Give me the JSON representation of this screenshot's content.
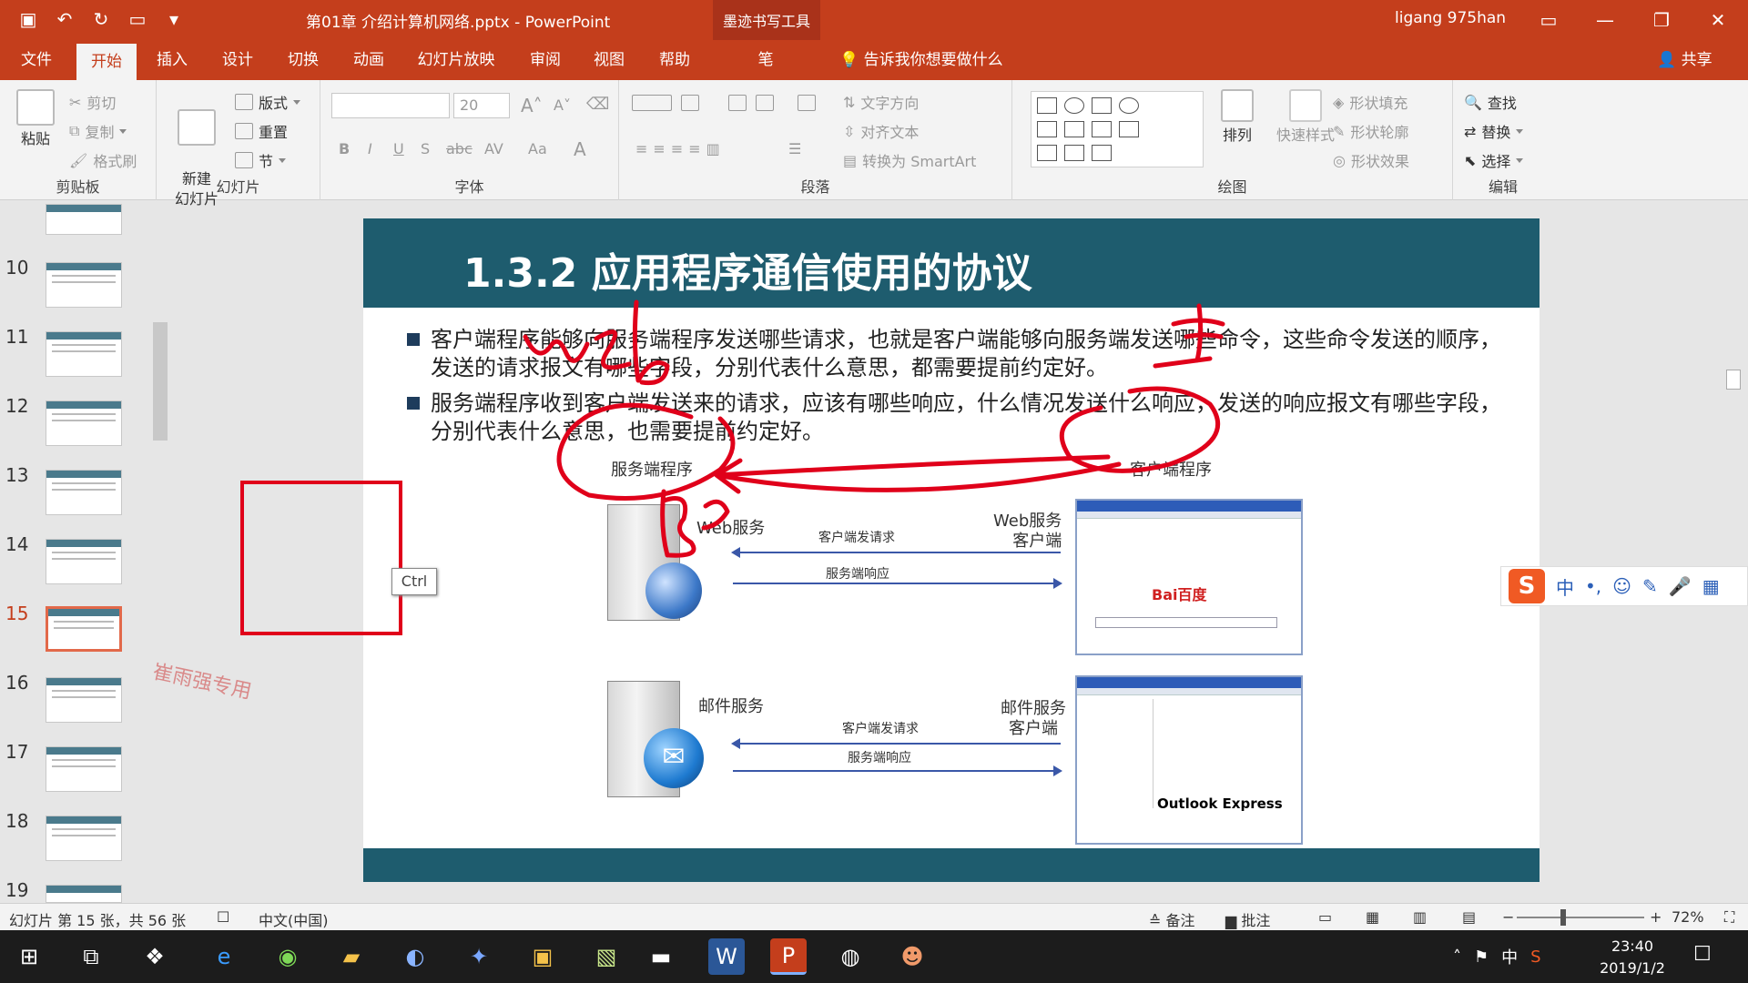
{
  "app": {
    "doc_title": "第01章 介绍计算机网络.pptx  -  PowerPoint",
    "contextual_tab": "墨迹书写工具",
    "user": "ligang 975han"
  },
  "tabs": [
    "文件",
    "开始",
    "插入",
    "设计",
    "切换",
    "动画",
    "幻灯片放映",
    "审阅",
    "视图",
    "帮助",
    "笔"
  ],
  "active_tab": "开始",
  "tell_me": "告诉我你想要做什么",
  "share": "共享",
  "ribbon": {
    "clipboard": {
      "label": "剪贴板",
      "paste": "粘贴",
      "cut": "剪切",
      "copy": "复制",
      "format_painter": "格式刷"
    },
    "slides": {
      "label": "幻灯片",
      "new_slide": "新建\n幻灯片",
      "layout": "版式",
      "reset": "重置",
      "section": "节"
    },
    "font": {
      "label": "字体",
      "font_name": "",
      "font_size": "20",
      "bold": "B",
      "italic": "I",
      "underline": "U",
      "shadow": "S",
      "strike": "abc",
      "spacing": "AV",
      "case": "Aa",
      "color": "A"
    },
    "paragraph": {
      "label": "段落",
      "text_direction": "文字方向",
      "align_text": "对齐文本",
      "smartart": "转换为 SmartArt"
    },
    "drawing": {
      "label": "绘图",
      "arrange": "排列",
      "quick_styles": "快速样式",
      "shape_fill": "形状填充",
      "shape_outline": "形状轮廓",
      "shape_effects": "形状效果"
    },
    "editing": {
      "label": "编辑",
      "find": "查找",
      "replace": "替换",
      "select": "选择"
    }
  },
  "thumbnails": [
    {
      "num": "10"
    },
    {
      "num": "11"
    },
    {
      "num": "12"
    },
    {
      "num": "13"
    },
    {
      "num": "14"
    },
    {
      "num": "15",
      "selected": true
    },
    {
      "num": "16"
    },
    {
      "num": "17"
    },
    {
      "num": "18"
    },
    {
      "num": "19"
    }
  ],
  "watermark_text": "崔雨强专用",
  "slide": {
    "title": "1.3.2 应用程序通信使用的协议",
    "bullets": [
      "客户端程序能够向服务端程序发送哪些请求，也就是客户端能够向服务端发送哪些命令，这些命令发送的顺序，发送的请求报文有哪些字段，分别代表什么意思，都需要提前约定好。",
      "服务端程序收到客户端发送来的请求，应该有哪些响应，什么情况发送什么响应，发送的响应报文有哪些字段，分别代表什么意思，也需要提前约定好。"
    ],
    "diagram": {
      "server_program": "服务端程序",
      "client_program": "客户端程序",
      "web_service": "Web服务",
      "web_client": "Web服务\n客户端",
      "mail_service": "邮件服务",
      "mail_client": "邮件服务\n客户端",
      "request": "客户端发请求",
      "response": "服务端响应",
      "baidu_logo": "Bai百度",
      "outlook_logo": "Outlook Express"
    }
  },
  "ctrl_tooltip": "Ctrl",
  "ime": {
    "lang": "中",
    "punct": "•,",
    "emoji": "☺",
    "pen": "✎",
    "mic": "🎤",
    "grid": "▦"
  },
  "status": {
    "slide_info": "幻灯片 第 15 张，共 56 张",
    "language": "中文(中国)",
    "notes": "备注",
    "comments": "批注",
    "zoom": "72%"
  },
  "taskbar": {
    "time": "23:40",
    "date": "2019/1/2",
    "ime": "中"
  },
  "colors": {
    "accent": "#c43e1c",
    "slide_header": "#1e5c6e",
    "ink": "#e0001a"
  }
}
